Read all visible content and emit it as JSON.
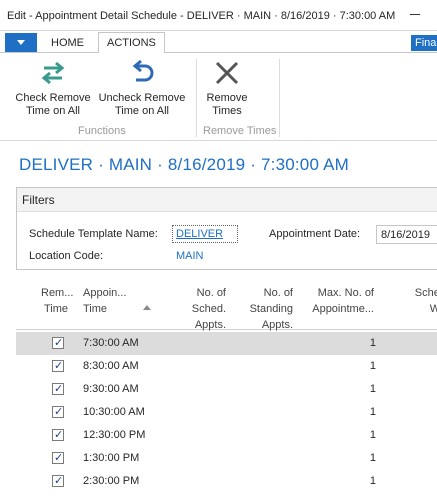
{
  "window": {
    "title": "Edit - Appointment Detail Schedule - DELIVER · MAIN · 8/16/2019 · 7:30:00 AM"
  },
  "ribbon": {
    "tabs": {
      "home": "HOME",
      "actions": "ACTIONS",
      "fin": "Fina"
    },
    "buttons": {
      "check_remove": "Check Remove Time on All",
      "uncheck_remove": "Uncheck Remove Time on All",
      "remove_times": "Remove Times"
    },
    "groups": {
      "functions": "Functions",
      "remove_times": "Remove Times"
    }
  },
  "page": {
    "title": "DELIVER · MAIN · 8/16/2019 · 7:30:00 AM"
  },
  "filters": {
    "header": "Filters",
    "schedule_template_label": "Schedule Template Name:",
    "schedule_template_value": "DELIVER",
    "location_code_label": "Location Code:",
    "location_code_value": "MAIN",
    "appointment_date_label": "Appointment Date:",
    "appointment_date_value": "8/16/2019"
  },
  "grid": {
    "headers": {
      "rem_time": "Rem... Time",
      "appointment_time": "Appoin... Time",
      "no_sched_appts": "No. of Sched. Appts.",
      "no_standing_appts": "No. of Standing Appts.",
      "max_no_appointments": "Max. No. of Appointme...",
      "sched_we": "Sched We"
    },
    "rows": [
      {
        "checked": true,
        "time": "7:30:00 AM",
        "max": "1"
      },
      {
        "checked": true,
        "time": "8:30:00 AM",
        "max": "1"
      },
      {
        "checked": true,
        "time": "9:30:00 AM",
        "max": "1"
      },
      {
        "checked": true,
        "time": "10:30:00 AM",
        "max": "1"
      },
      {
        "checked": true,
        "time": "12:30:00 PM",
        "max": "1"
      },
      {
        "checked": true,
        "time": "1:30:00 PM",
        "max": "1"
      },
      {
        "checked": true,
        "time": "2:30:00 PM",
        "max": "1"
      }
    ]
  },
  "colors": {
    "accent": "#1f6fc5",
    "selected_row": "#dcdcdc",
    "icon_teal": "#3a9a8e"
  },
  "icons": {
    "check_remove": "swap-arrows-icon",
    "uncheck_remove": "undo-arrow-icon",
    "remove_times": "x-cross-icon"
  }
}
